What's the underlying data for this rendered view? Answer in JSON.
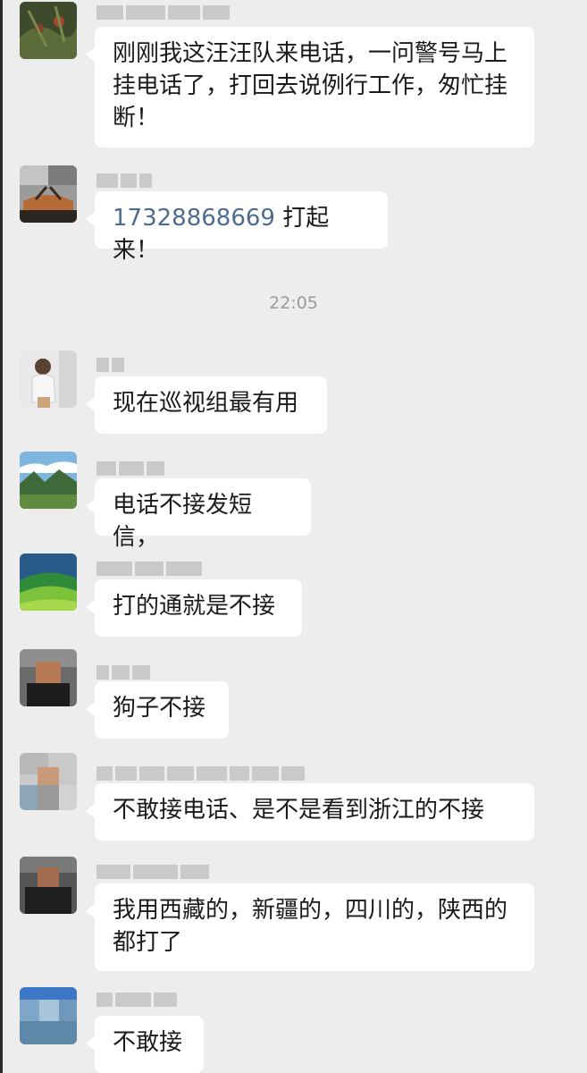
{
  "chat": {
    "timestamp": "22:05",
    "messages": [
      {
        "text": "刚刚我这汪汪队来电话，一问警号马上挂电话了，打回去说例行工作，匆忙挂断！"
      },
      {
        "phone": "17328868669",
        "text": " 打起来！"
      },
      {
        "text": "现在巡视组最有用"
      },
      {
        "text": "电话不接发短信，"
      },
      {
        "text": "打的通就是不接"
      },
      {
        "text": "狗子不接"
      },
      {
        "text": "不敢接电话、是不是看到浙江的不接"
      },
      {
        "text": "我用西藏的，新疆的，四川的，陕西的都打了"
      },
      {
        "text": "不敢接"
      }
    ]
  }
}
